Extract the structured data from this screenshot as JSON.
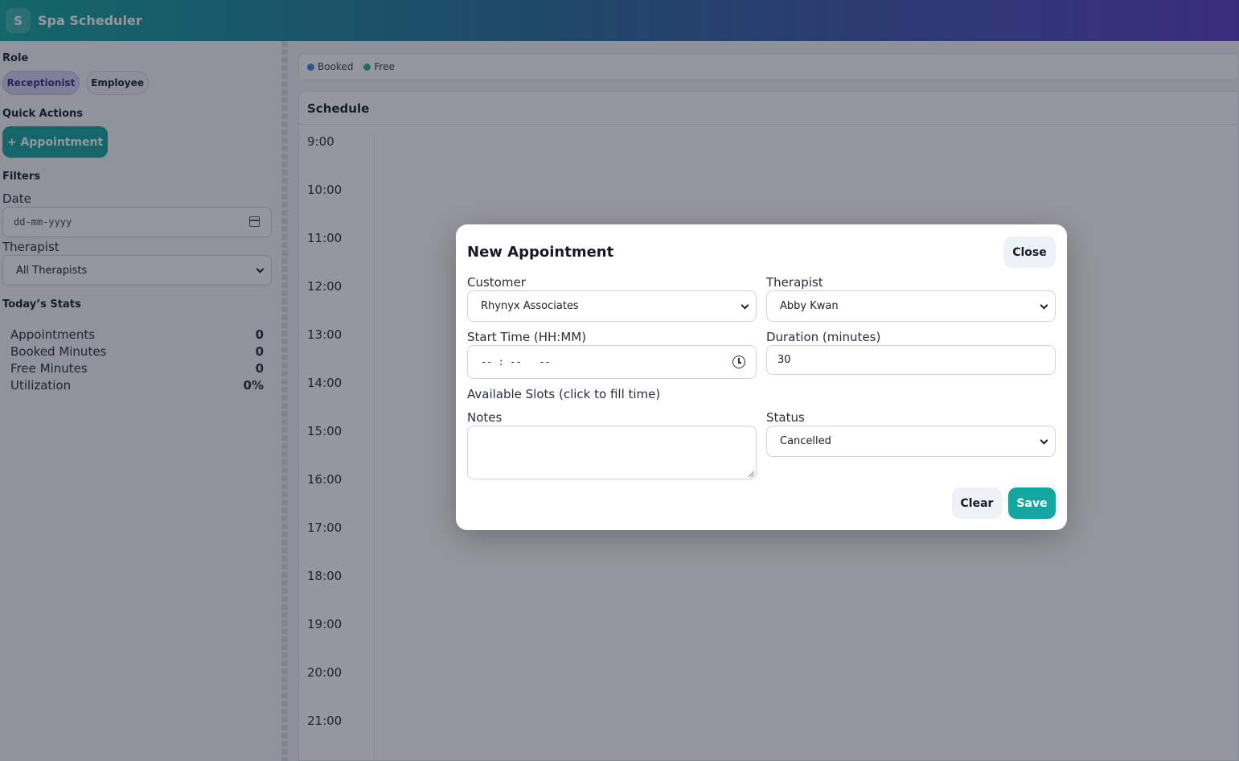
{
  "app": {
    "logo_letter": "S",
    "title": "Spa Scheduler"
  },
  "sidebar": {
    "role_title": "Role",
    "roles": [
      {
        "label": "Receptionist",
        "active": true
      },
      {
        "label": "Employee",
        "active": false
      }
    ],
    "quick_actions_title": "Quick Actions",
    "add_appointment_label": "+ Appointment",
    "filters_title": "Filters",
    "date_label": "Date",
    "date_placeholder": "dd-mm-yyyy",
    "therapist_label": "Therapist",
    "therapist_value": "All Therapists",
    "stats_title": "Today’s Stats",
    "stats": [
      {
        "label": "Appointments",
        "value": "0"
      },
      {
        "label": "Booked Minutes",
        "value": "0"
      },
      {
        "label": "Free Minutes",
        "value": "0"
      },
      {
        "label": "Utilization",
        "value": "0%"
      }
    ]
  },
  "legend": [
    {
      "label": "Booked",
      "color": "#4f7fd6"
    },
    {
      "label": "Free",
      "color": "#3fb07a"
    }
  ],
  "schedule": {
    "title": "Schedule",
    "hours": [
      "9:00",
      "10:00",
      "11:00",
      "12:00",
      "13:00",
      "14:00",
      "15:00",
      "16:00",
      "17:00",
      "18:00",
      "19:00",
      "20:00",
      "21:00"
    ]
  },
  "modal": {
    "title": "New Appointment",
    "close_label": "Close",
    "customer_label": "Customer",
    "customer_value": "Rhynyx Associates",
    "therapist_label": "Therapist",
    "therapist_value": "Abby Kwan",
    "start_time_label": "Start Time (HH:MM)",
    "start_time_placeholder": "-- : --   --",
    "duration_label": "Duration (minutes)",
    "duration_value": "30",
    "slots_label": "Available Slots (click to fill time)",
    "notes_label": "Notes",
    "status_label": "Status",
    "status_value": "Cancelled",
    "clear_label": "Clear",
    "save_label": "Save"
  }
}
